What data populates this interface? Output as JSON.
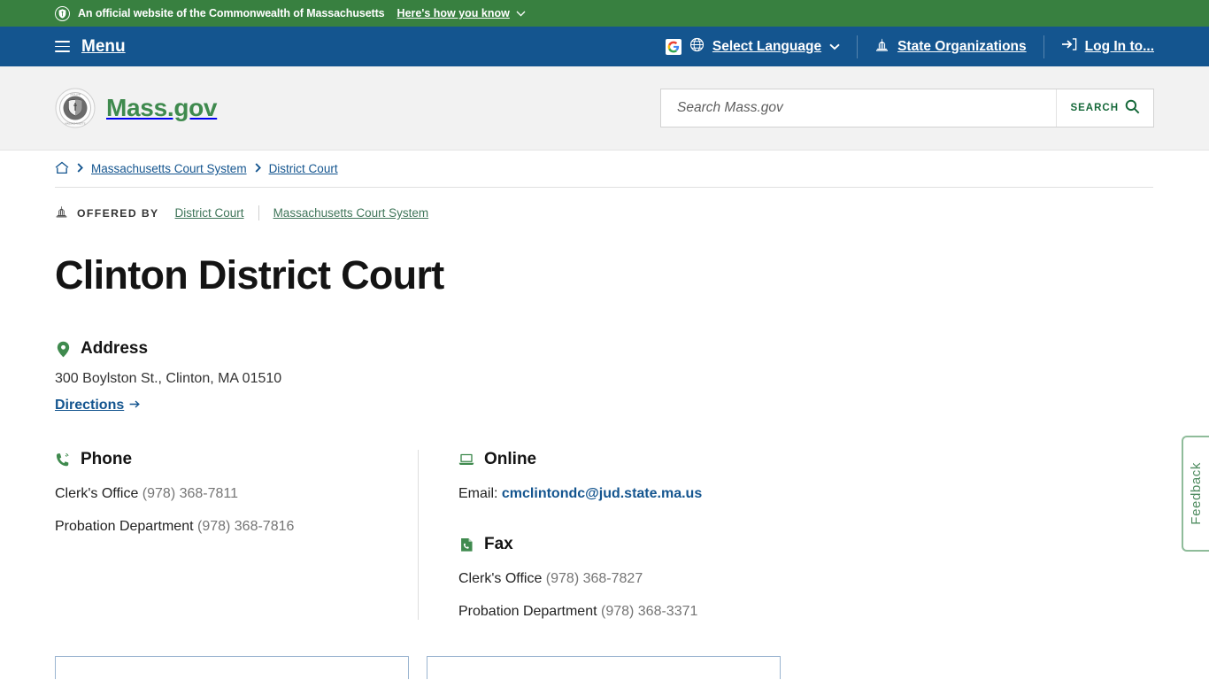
{
  "gov_banner": {
    "icon": "shield-icon",
    "text": "An official website of the Commonwealth of Massachusetts",
    "how_you_know": "Here's how you know",
    "chevron": "⌄",
    "background": "#388040"
  },
  "utility_nav": {
    "background": "#14558f",
    "menu_label": "Menu",
    "language": {
      "google_icon": "google-logo-icon",
      "globe_icon": "globe-icon",
      "label": "Select Language",
      "chevron": "⌄"
    },
    "state_orgs": {
      "icon": "capitol-icon",
      "label": "State Organizations"
    },
    "login": {
      "icon": "login-arrow-icon",
      "label": "Log In to..."
    }
  },
  "brand": {
    "seal_icon": "massachusetts-state-seal-icon",
    "name": "Mass.gov",
    "color": "#3f8a4e"
  },
  "search": {
    "placeholder": "Search Mass.gov",
    "value": "",
    "button_label": "SEARCH",
    "button_icon": "search-icon"
  },
  "breadcrumb": {
    "home_icon": "home-icon",
    "separator": "›",
    "items": [
      {
        "label": "Massachusetts Court System"
      },
      {
        "label": "District Court"
      }
    ]
  },
  "offered_by": {
    "icon": "capitol-icon",
    "label": "OFFERED BY",
    "links": [
      {
        "label": "District Court"
      },
      {
        "label": "Massachusetts Court System"
      }
    ]
  },
  "page_title": "Clinton District Court",
  "address": {
    "icon": "map-pin-icon",
    "heading": "Address",
    "line": "300 Boylston St., Clinton, MA 01510",
    "directions_label": "Directions",
    "directions_arrow": "→"
  },
  "phone": {
    "icon": "phone-icon",
    "heading": "Phone",
    "entries": [
      {
        "label": "Clerk's Office",
        "number": "(978) 368-7811"
      },
      {
        "label": "Probation Department",
        "number": "(978) 368-7816"
      }
    ]
  },
  "online": {
    "icon": "laptop-icon",
    "heading": "Online",
    "email_label": "Email:",
    "email": "cmclintondc@jud.state.ma.us"
  },
  "fax": {
    "icon": "fax-icon",
    "heading": "Fax",
    "entries": [
      {
        "label": "Clerk's Office",
        "number": "(978) 368-7827"
      },
      {
        "label": "Probation Department",
        "number": "(978) 368-3371"
      }
    ]
  },
  "feedback": {
    "label": "Feedback",
    "color": "#4f8c60"
  }
}
